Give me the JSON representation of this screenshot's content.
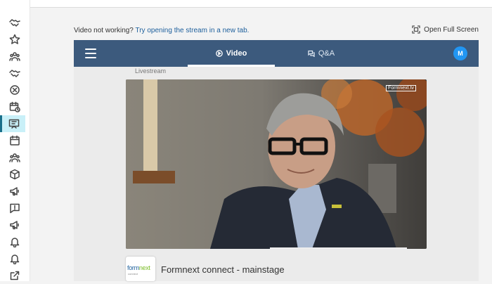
{
  "sidebar": {
    "items": [
      {
        "icon": "handshake-icon"
      },
      {
        "icon": "star-icon"
      },
      {
        "icon": "people-group-icon"
      },
      {
        "icon": "handshake-icon"
      },
      {
        "icon": "close-circle-icon"
      },
      {
        "icon": "calendar-clock-icon"
      },
      {
        "icon": "presentation-icon",
        "active": true
      },
      {
        "icon": "calendar-icon"
      },
      {
        "icon": "people-group-icon"
      },
      {
        "icon": "box-icon"
      },
      {
        "icon": "megaphone-icon"
      },
      {
        "icon": "alert-message-icon"
      },
      {
        "icon": "megaphone-icon"
      },
      {
        "icon": "bell-icon"
      },
      {
        "icon": "bell-icon"
      },
      {
        "icon": "external-link-icon"
      }
    ]
  },
  "notice": {
    "text": "Video not working?",
    "link": "Try opening the stream in a new tab."
  },
  "fullscreen": {
    "label": "Open Full Screen"
  },
  "nav": {
    "tabs": [
      {
        "label": "Video",
        "icon": "play-circle-icon",
        "active": true
      },
      {
        "label": "Q&A",
        "icon": "chat-bubbles-icon"
      }
    ],
    "avatar_initial": "M"
  },
  "stream": {
    "label": "Livestream",
    "badge": "Formnext.tv"
  },
  "event": {
    "logo_text_a": "form",
    "logo_text_b": "next",
    "logo_sub": "connect",
    "title": "Formnext connect - mainstage"
  },
  "colors": {
    "navbar": "#3c5a7d",
    "accent": "#2196f3",
    "active_sidebar": "#c9f0f8",
    "link": "#1d5f9c"
  }
}
